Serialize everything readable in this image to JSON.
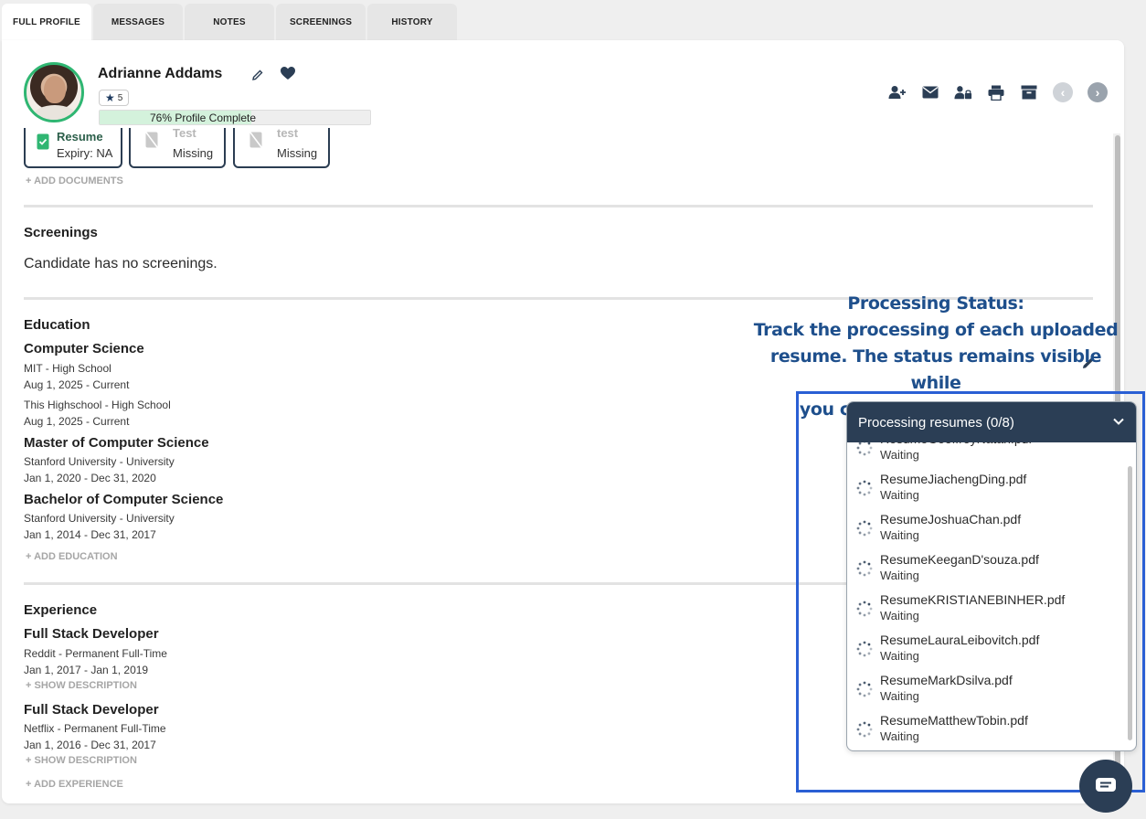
{
  "tabs": [
    "FULL PROFILE",
    "MESSAGES",
    "NOTES",
    "SCREENINGS",
    "HISTORY"
  ],
  "profile": {
    "name": "Adrianne Addams",
    "rating": "5",
    "progress_text": "76% Profile Complete",
    "progress_fraction": 0.76
  },
  "documents": [
    {
      "title": "Resume",
      "subtitle": "Expiry: NA"
    },
    {
      "title": "Test",
      "subtitle": "Missing"
    },
    {
      "title": "test",
      "subtitle": "Missing"
    }
  ],
  "add_documents": "+ ADD DOCUMENTS",
  "screenings": {
    "title": "Screenings",
    "empty_text": "Candidate has no screenings."
  },
  "education": {
    "title": "Education",
    "entries": [
      {
        "degree": "Computer Science",
        "lines": [
          "MIT - High School",
          "Aug 1, 2025 - Current",
          "This Highschool - High School",
          "Aug 1, 2025 - Current"
        ]
      },
      {
        "degree": "Master of Computer Science",
        "lines": [
          "Stanford University - University",
          "Jan 1, 2020 - Dec 31, 2020"
        ]
      },
      {
        "degree": "Bachelor of Computer Science",
        "lines": [
          "Stanford University - University",
          "Jan 1, 2014 - Dec 31, 2017"
        ]
      }
    ],
    "add_label": "+ ADD EDUCATION"
  },
  "experience": {
    "title": "Experience",
    "entries": [
      {
        "role": "Full Stack Developer",
        "company": "Reddit - Permanent Full-Time",
        "dates": "Jan 1, 2017 - Jan 1, 2019",
        "show": "+ SHOW DESCRIPTION"
      },
      {
        "role": "Full Stack Developer",
        "company": "Netflix - Permanent Full-Time",
        "dates": "Jan 1, 2016 - Dec 31, 2017",
        "show": "+ SHOW DESCRIPTION"
      }
    ],
    "add_label": "+ ADD EXPERIENCE"
  },
  "annotation": {
    "heading": "Processing Status:",
    "line1": "Track the processing of each uploaded",
    "line2": "resume. The status remains visible while",
    "line3": "you continue using Labourly."
  },
  "processing": {
    "title": "Processing resumes (0/8)",
    "files": [
      {
        "name": "ResumeGeoffreyNatan.pdf",
        "status": "Waiting"
      },
      {
        "name": "ResumeJiachengDing.pdf",
        "status": "Waiting"
      },
      {
        "name": "ResumeJoshuaChan.pdf",
        "status": "Waiting"
      },
      {
        "name": "ResumeKeeganD'souza.pdf",
        "status": "Waiting"
      },
      {
        "name": "ResumeKRISTIANEBINHER.pdf",
        "status": "Waiting"
      },
      {
        "name": "ResumeLauraLeibovitch.pdf",
        "status": "Waiting"
      },
      {
        "name": "ResumeMarkDsilva.pdf",
        "status": "Waiting"
      },
      {
        "name": "ResumeMatthewTobin.pdf",
        "status": "Waiting"
      }
    ]
  },
  "icons": {
    "toolbar": [
      "add-user-icon",
      "mail-icon",
      "lock-user-icon",
      "print-icon",
      "archive-icon",
      "chevron-left-icon",
      "chevron-right-icon"
    ]
  },
  "colors": {
    "navy": "#2b3e55",
    "accent_green": "#2fb672",
    "annotation_blue": "#1e4f8c",
    "highlight_box": "#2a5fd4"
  }
}
